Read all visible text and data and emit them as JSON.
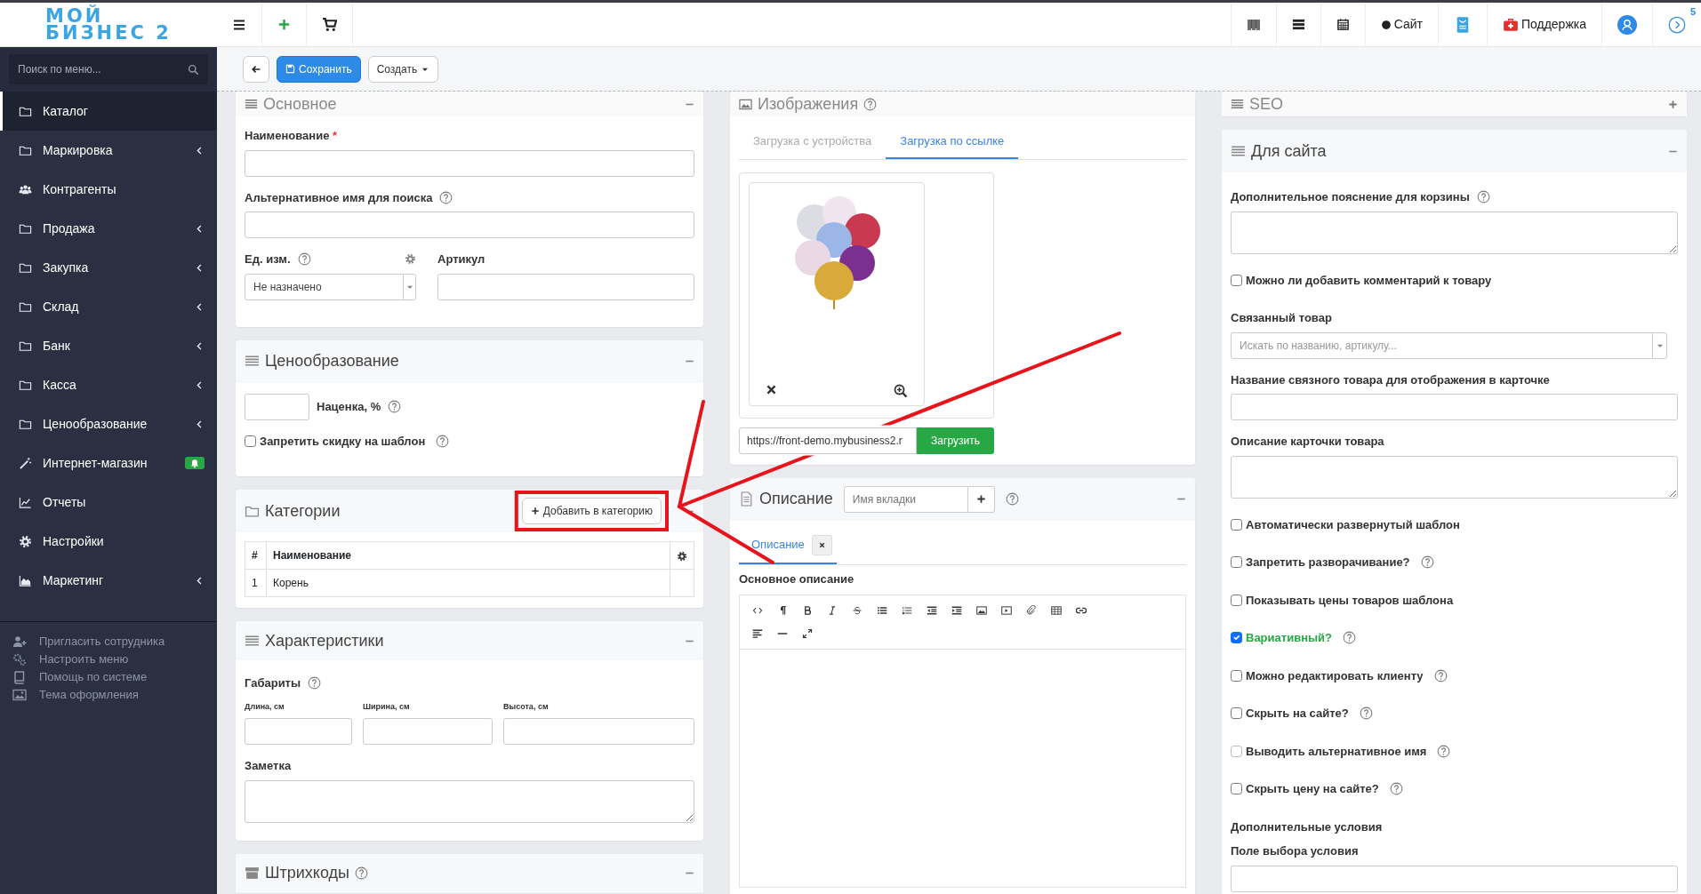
{
  "logo": {
    "lines": [
      "МОЙ",
      "БИЗНЕС 2"
    ]
  },
  "topbar": {
    "right_items": [
      {
        "kind": "barcode"
      },
      {
        "kind": "list"
      },
      {
        "kind": "calendar"
      },
      {
        "kind": "site",
        "label": "Сайт"
      },
      {
        "kind": "device"
      },
      {
        "kind": "support",
        "label": "Поддержка"
      },
      {
        "kind": "user"
      },
      {
        "kind": "notifications",
        "badge": "5"
      }
    ]
  },
  "actions": {
    "save": "Сохранить",
    "create": "Создать"
  },
  "sidebar": {
    "search_placeholder": "Поиск по меню...",
    "items": [
      {
        "label": "Каталог",
        "kind": "folder",
        "submenu": false,
        "selected": true,
        "notification": false
      },
      {
        "label": "Маркировка",
        "kind": "folder",
        "submenu": true,
        "selected": false,
        "notification": false
      },
      {
        "label": "Контрагенты",
        "kind": "users",
        "submenu": false,
        "selected": false,
        "notification": false
      },
      {
        "label": "Продажа",
        "kind": "folder",
        "submenu": true,
        "selected": false,
        "notification": false
      },
      {
        "label": "Закупка",
        "kind": "folder",
        "submenu": true,
        "selected": false,
        "notification": false
      },
      {
        "label": "Склад",
        "kind": "folder",
        "submenu": true,
        "selected": false,
        "notification": false
      },
      {
        "label": "Банк",
        "kind": "folder",
        "submenu": true,
        "selected": false,
        "notification": false
      },
      {
        "label": "Касса",
        "kind": "folder",
        "submenu": true,
        "selected": false,
        "notification": false
      },
      {
        "label": "Ценообразование",
        "kind": "folder",
        "submenu": true,
        "selected": false,
        "notification": false
      },
      {
        "label": "Интернет-магазин",
        "kind": "wand",
        "submenu": false,
        "selected": false,
        "notification": true
      },
      {
        "label": "Отчеты",
        "kind": "chart",
        "submenu": false,
        "selected": false,
        "notification": false
      },
      {
        "label": "Настройки",
        "kind": "gear",
        "submenu": false,
        "selected": false,
        "notification": false
      },
      {
        "label": "Маркетинг",
        "kind": "area",
        "submenu": true,
        "selected": false,
        "notification": false
      }
    ],
    "footer_links": [
      {
        "kind": "userplus",
        "label": "Пригласить сотрудника"
      },
      {
        "kind": "cogs",
        "label": "Настроить меню"
      },
      {
        "kind": "book",
        "label": "Помощь по системе"
      },
      {
        "kind": "picture",
        "label": "Тема оформления"
      }
    ]
  },
  "panels": {
    "main": {
      "title": "Основное",
      "name_label": "Наименование",
      "required_mark": "*",
      "alt_label": "Альтернативное имя для поиска",
      "unit_label": "Ед. изм.",
      "unit_value": "Не назначено",
      "sku_label": "Артикул"
    },
    "pricing": {
      "title": "Ценообразование",
      "markup_label": "Наценка, %",
      "no_discount": {
        "label": "Запретить скидку на шаблон",
        "checked": false
      }
    },
    "categories": {
      "title": "Категории",
      "add_button": "Добавить в категорию",
      "columns": [
        "#",
        "Наименование"
      ],
      "rows": [
        [
          "1",
          "Корень"
        ]
      ]
    },
    "characteristics": {
      "title": "Характеристики",
      "dimensions_label": "Габариты",
      "fields": [
        "Длина, см",
        "Ширина, см",
        "Высота, см"
      ],
      "note_label": "Заметка"
    },
    "barcodes": {
      "title": "Штрихкоды"
    },
    "images": {
      "title": "Изображения",
      "tabs": [
        {
          "label": "Загрузка с устройства",
          "selected": false
        },
        {
          "label": "Загрузка по ссылке",
          "selected": true
        }
      ],
      "url_value": "https://front-demo.mybusiness2.r",
      "upload_button": "Загрузить"
    },
    "description": {
      "title": "Описание",
      "tab_name_placeholder": "Имя вкладки",
      "tabs": [
        {
          "label": "Описание",
          "selected": true
        }
      ],
      "editor_label": "Основное описание"
    },
    "seo": {
      "title": "SEO"
    },
    "site": {
      "title": "Для сайта",
      "fields": [
        {
          "kind": "textarea",
          "label": "Дополнительное пояснение для корзины",
          "help": true
        },
        {
          "kind": "checkbox",
          "label": "Можно ли добавить комментарий к товару",
          "checked": false,
          "disabled": false,
          "help": false
        },
        {
          "kind": "select",
          "label": "Связанный товар",
          "placeholder": "Искать по названию, артикулу...",
          "help": false
        },
        {
          "kind": "input",
          "label": "Название связного товара для отображения в карточке",
          "help": false
        },
        {
          "kind": "textarea",
          "label": "Описание карточки товара",
          "help": false
        },
        {
          "kind": "checkbox",
          "label": "Автоматически развернутый шаблон",
          "checked": false,
          "disabled": false,
          "help": false
        },
        {
          "kind": "checkbox",
          "label": "Запретить разворачивание?",
          "checked": false,
          "disabled": false,
          "help": true
        },
        {
          "kind": "checkbox",
          "label": "Показывать цены товаров шаблона",
          "checked": false,
          "disabled": false,
          "help": false
        },
        {
          "kind": "checkbox",
          "label": "Вариативный?",
          "checked": true,
          "disabled": false,
          "help": true
        },
        {
          "kind": "checkbox",
          "label": "Можно редактировать клиенту",
          "checked": false,
          "disabled": false,
          "help": true
        },
        {
          "kind": "checkbox",
          "label": "Скрыть на сайте?",
          "checked": false,
          "disabled": false,
          "help": true
        },
        {
          "kind": "checkbox",
          "label": "Выводить альтернативное имя",
          "checked": false,
          "disabled": true,
          "help": true
        },
        {
          "kind": "checkbox",
          "label": "Скрыть цену на сайте?",
          "checked": false,
          "disabled": false,
          "help": true
        },
        {
          "kind": "heading",
          "label": "Дополнительные условия",
          "help": false
        },
        {
          "kind": "input",
          "label": "Поле выбора условия",
          "help": false
        }
      ]
    }
  }
}
